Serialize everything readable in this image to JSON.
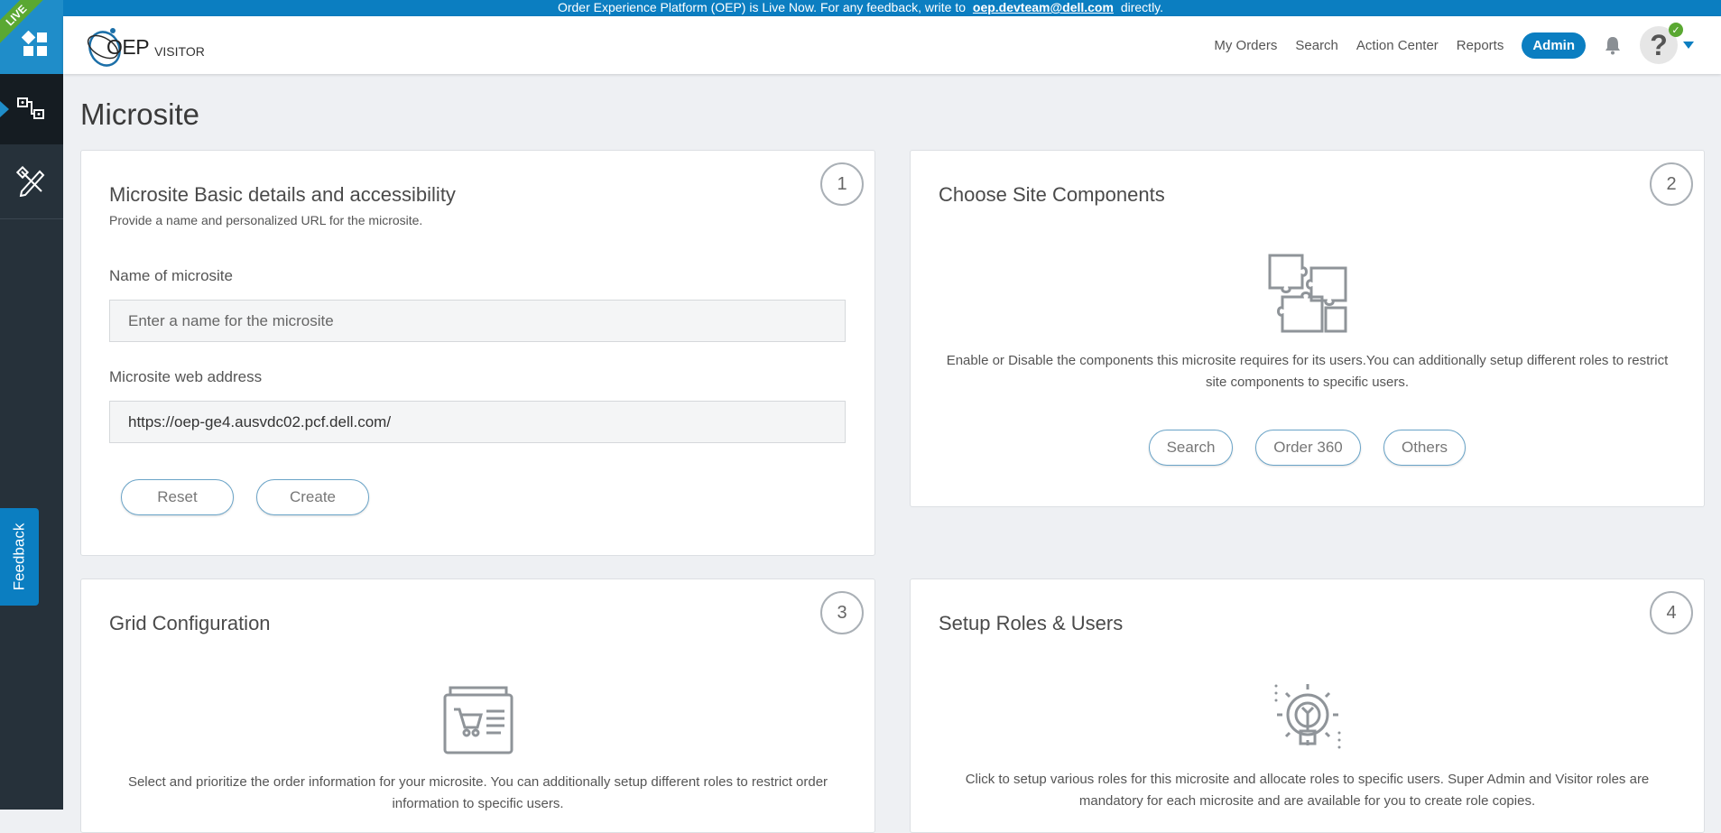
{
  "banner": {
    "text_before": "Order Experience Platform (OEP) is Live Now. For any feedback, write to",
    "email": "oep.devteam@dell.com",
    "text_after": "directly."
  },
  "rail": {
    "live_label": "LIVE",
    "feedback_label": "Feedback"
  },
  "header": {
    "logo_text": "OEP",
    "logo_sub": "VISITOR",
    "nav": [
      "My Orders",
      "Search",
      "Action Center",
      "Reports"
    ],
    "admin_label": "Admin",
    "avatar_glyph": "?"
  },
  "page": {
    "title": "Microsite"
  },
  "card1": {
    "step": "1",
    "title": "Microsite Basic details and accessibility",
    "subtitle": "Provide a name and personalized URL for the microsite.",
    "name_label": "Name of microsite",
    "name_placeholder": "Enter a name for the microsite",
    "url_label": "Microsite web address",
    "url_value": "https://oep-ge4.ausvdc02.pcf.dell.com/",
    "reset_label": "Reset",
    "create_label": "Create"
  },
  "card2": {
    "step": "2",
    "title": "Choose Site Components",
    "description": "Enable or Disable the components this microsite requires for its users.You can additionally setup different roles to restrict site components to specific users.",
    "buttons": [
      "Search",
      "Order 360",
      "Others"
    ]
  },
  "card3": {
    "step": "3",
    "title": "Grid Configuration",
    "description": "Select and prioritize the order information for your microsite. You can additionally setup different roles to restrict order information to specific users."
  },
  "card4": {
    "step": "4",
    "title": "Setup Roles & Users",
    "description": "Click to setup various roles for this microsite and allocate roles to specific users. Super Admin and Visitor roles are mandatory for each microsite and are available for you to create role copies."
  },
  "colors": {
    "brand_blue": "#0b7ec1",
    "rail_dark": "#26313a",
    "live_green": "#5aa832"
  },
  "icons": [
    "apps-grid-icon",
    "microsite-icon",
    "design-tools-icon",
    "bell-icon",
    "chevron-down-icon",
    "puzzle-icon",
    "cart-list-icon",
    "gear-wrench-icon"
  ]
}
